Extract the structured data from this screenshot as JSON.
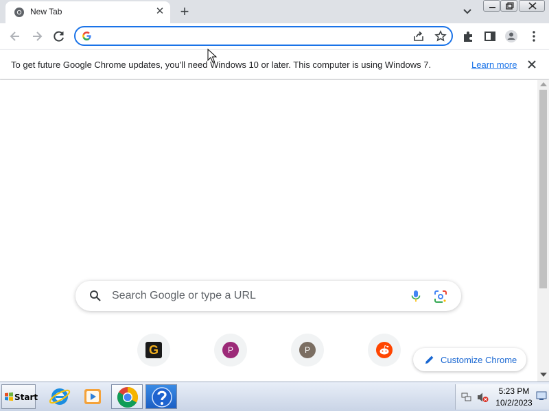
{
  "tab": {
    "title": "New Tab"
  },
  "infobar": {
    "message": "To get future Google Chrome updates, you'll need Windows 10 or later. This computer is using Windows 7.",
    "link": "Learn more"
  },
  "ntp": {
    "search_placeholder": "Search Google or type a URL",
    "shortcuts": [
      {
        "icon": "G",
        "color": "#f2b01e"
      },
      {
        "icon": "P",
        "color": "#9c2a78"
      },
      {
        "icon": "P",
        "color": "#7b6e62"
      },
      {
        "icon": "reddit-icon",
        "color": "#ff4500"
      }
    ],
    "customize_label": "Customize Chrome"
  },
  "taskbar": {
    "start_label": "Start",
    "time": "5:23 PM",
    "date": "10/2/2023"
  },
  "colors": {
    "accent": "#1a73e8",
    "link": "#1967d2",
    "tabstrip": "#dee1e6"
  }
}
